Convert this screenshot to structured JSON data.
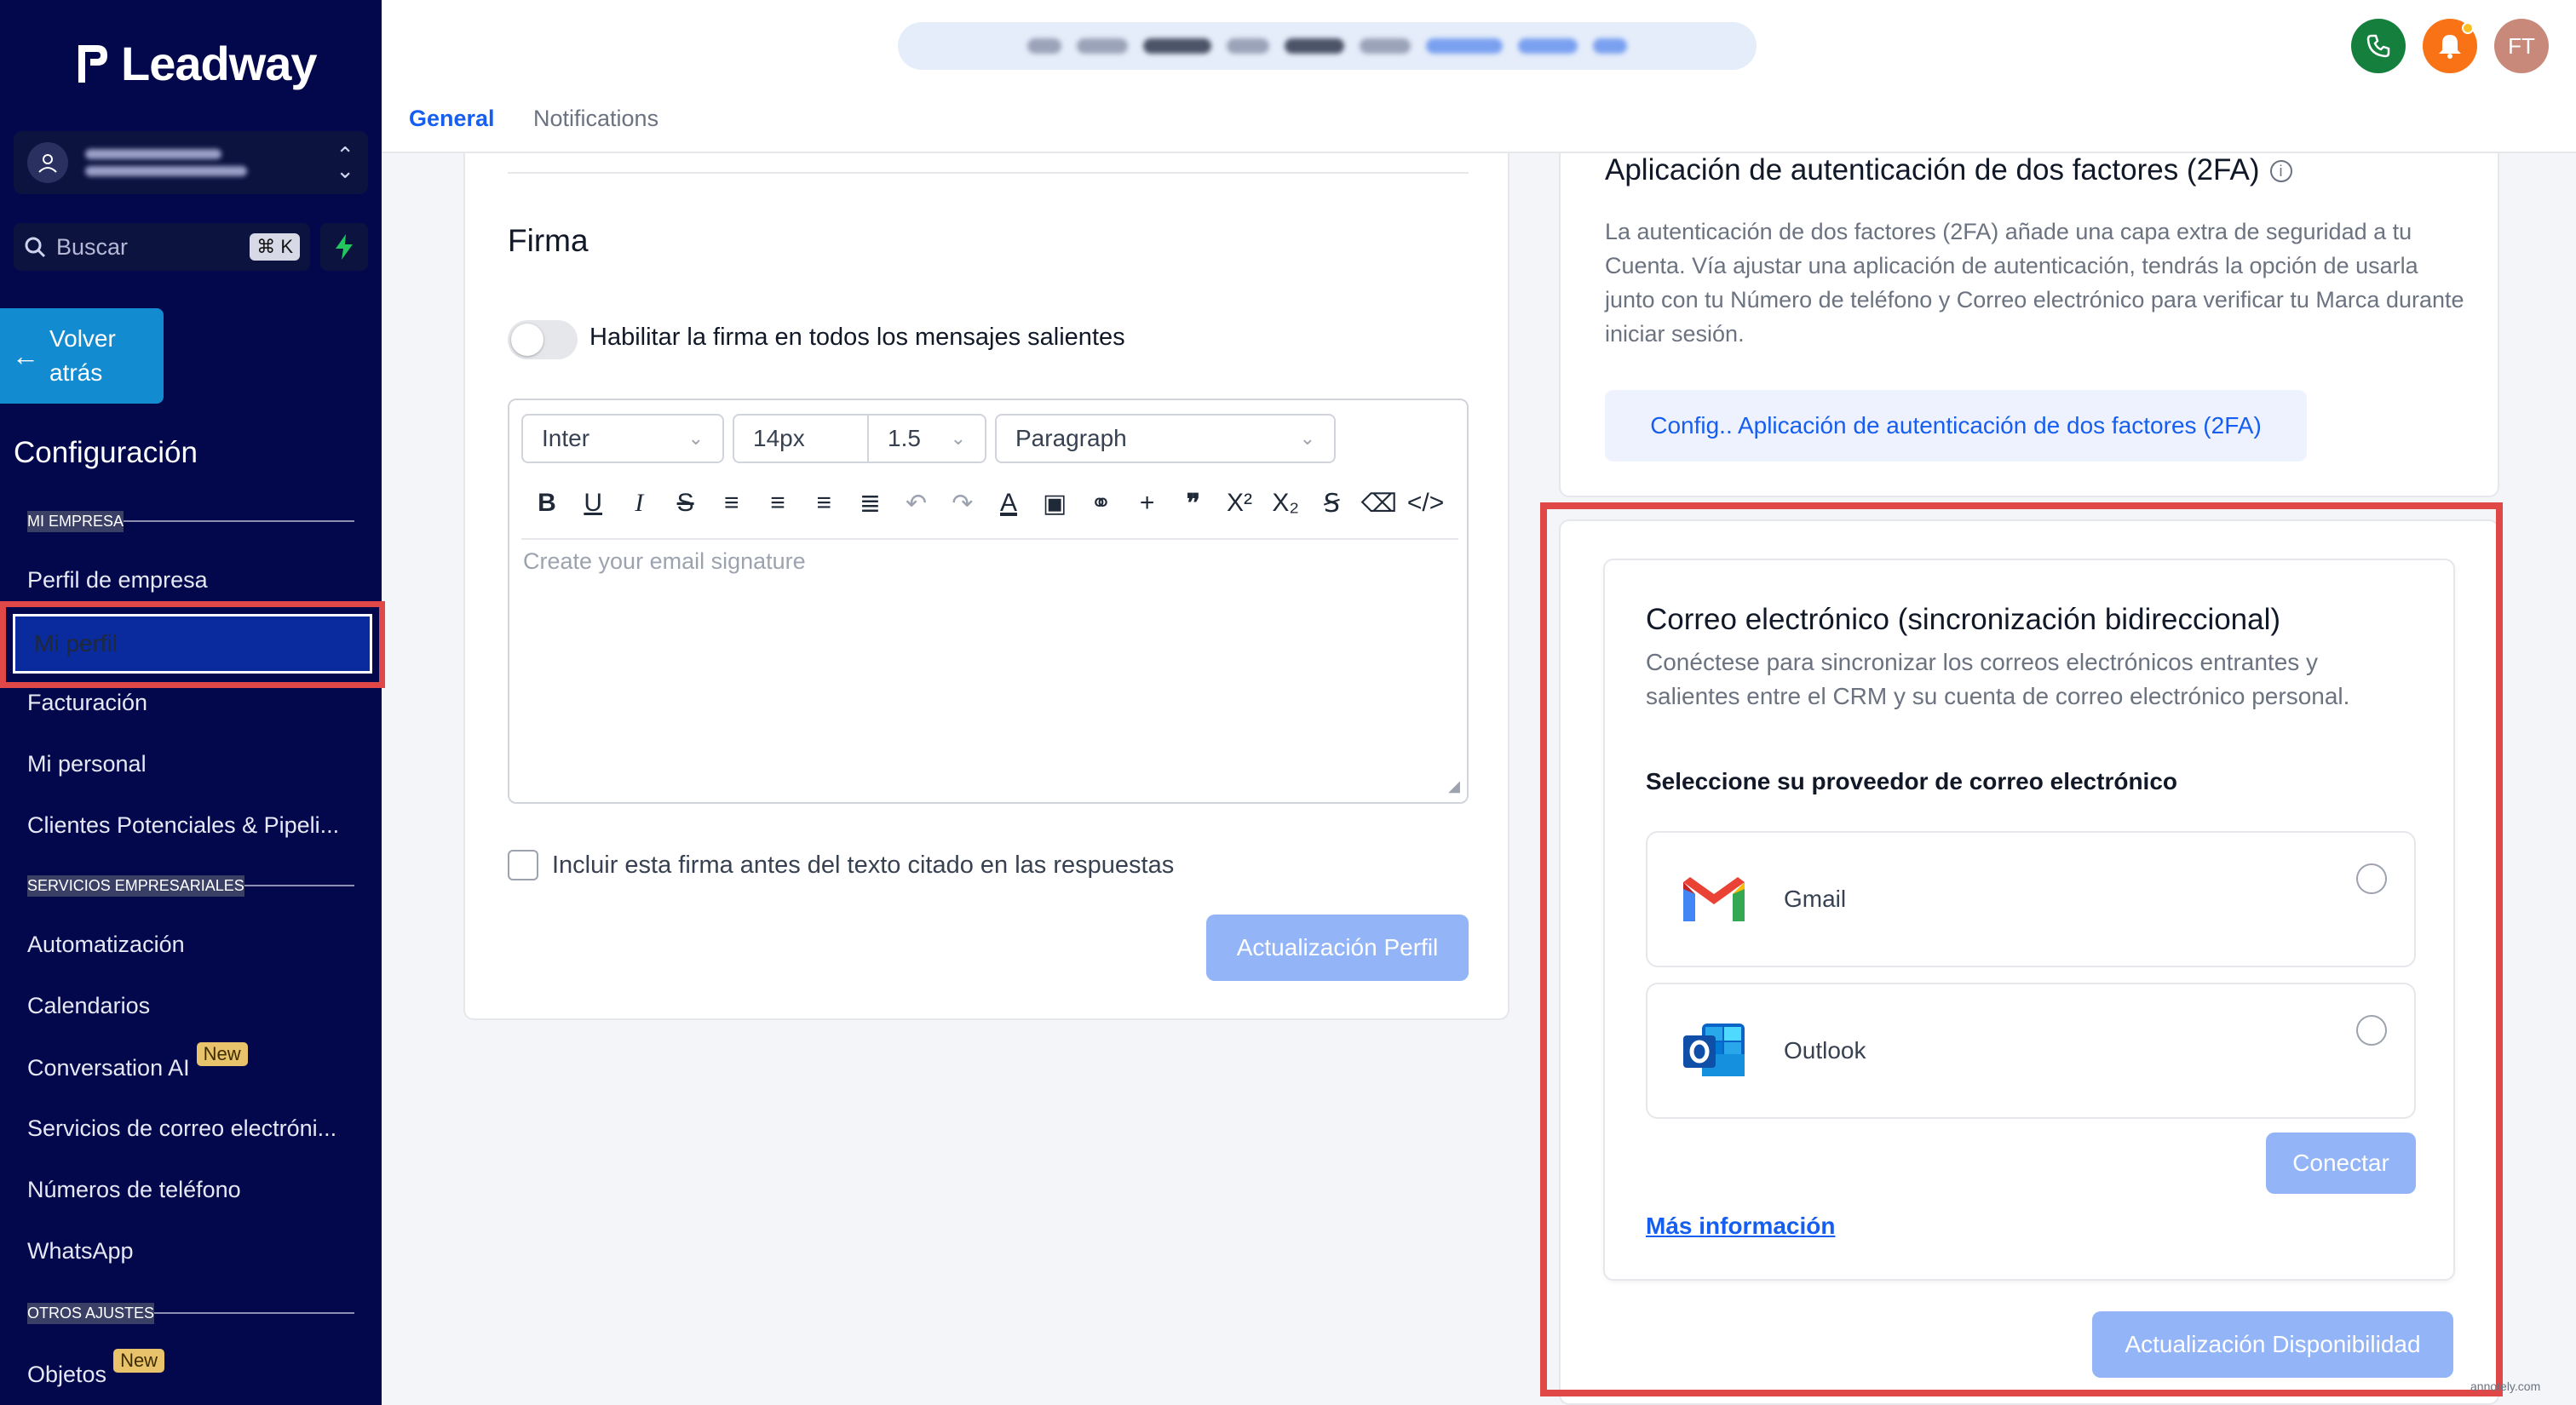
{
  "brand": {
    "name": "Leadway"
  },
  "sidebar": {
    "search_placeholder": "Buscar",
    "search_shortcut": "⌘ K",
    "back_label_line1": "Volver",
    "back_label_line2": "atrás",
    "title": "Configuración",
    "sections": {
      "empresa": "MI EMPRESA",
      "servicios": "SERVICIOS EMPRESARIALES",
      "otros": "OTROS AJUSTES"
    },
    "items": {
      "perfil_empresa": "Perfil de empresa",
      "mi_perfil": "Mi perfil",
      "facturacion": "Facturación",
      "mi_personal": "Mi personal",
      "clientes": "Clientes Potenciales & Pipeli...",
      "automatizacion": "Automatización",
      "calendarios": "Calendarios",
      "conversation_ai": "Conversation AI",
      "servicios_correo": "Servicios de correo electróni...",
      "numeros": "Números de teléfono",
      "whatsapp": "WhatsApp",
      "objetos": "Objetos"
    },
    "badge_new": "New"
  },
  "header": {
    "tabs": {
      "general": "General",
      "notifications": "Notifications"
    },
    "avatar_initials": "FT"
  },
  "signature": {
    "title": "Firma",
    "toggle_label": "Habilitar la firma en todos los mensajes salientes",
    "font": "Inter",
    "size": "14px",
    "line_height": "1.5",
    "block": "Paragraph",
    "placeholder": "Create your email signature",
    "checkbox_label": "Incluir esta firma antes del texto citado en las respuestas",
    "update_button": "Actualización Perfil"
  },
  "two_fa": {
    "title": "Aplicación de autenticación de dos factores (2FA)",
    "description": "La autenticación de dos factores (2FA) añade una capa extra de seguridad a tu Cuenta. Vía ajustar una aplicación de autenticación, tendrás la opción de usarla junto con tu Número de teléfono y Correo electrónico para verificar tu Marca durante iniciar sesión.",
    "button": "Config.. Aplicación de autenticación de dos factores (2FA)"
  },
  "email_sync": {
    "title": "Correo electrónico (sincronización bidireccional)",
    "description": "Conéctese para sincronizar los correos electrónicos entrantes y salientes entre el CRM y su cuenta de correo electrónico personal.",
    "provider_label": "Seleccione su proveedor de correo electrónico",
    "providers": {
      "gmail": "Gmail",
      "outlook": "Outlook"
    },
    "connect_button": "Conectar",
    "more_info": "Más información",
    "availability_button": "Actualización Disponibilidad"
  },
  "watermark": "annotely.com",
  "colors": {
    "sidebar": "#02084b",
    "accent": "#155eef",
    "highlight": "#e04848"
  }
}
